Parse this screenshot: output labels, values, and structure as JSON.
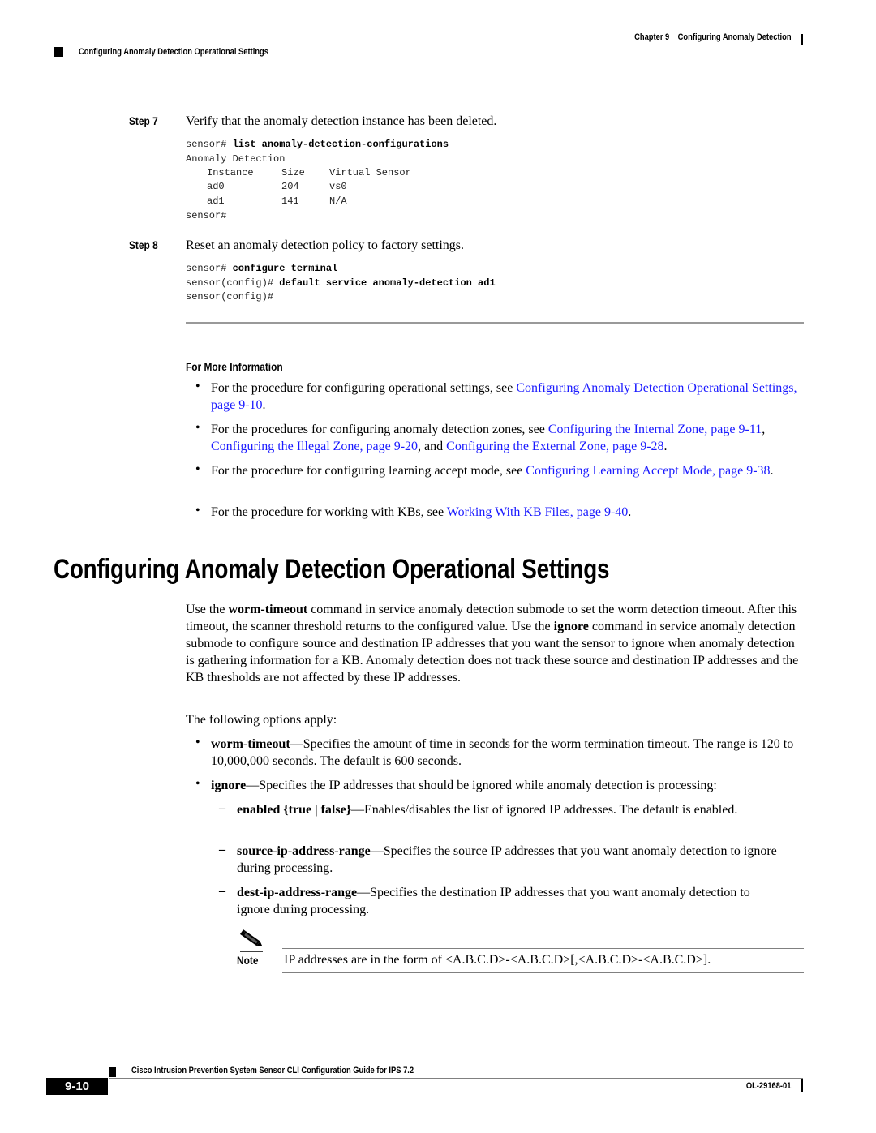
{
  "header": {
    "chapter_label": "Chapter 9",
    "chapter_title": "Configuring Anomaly Detection",
    "section_title": "Configuring Anomaly Detection Operational Settings"
  },
  "steps": [
    {
      "label": "Step 7",
      "text": "Verify that the anomaly detection instance has been deleted.",
      "code": {
        "prompt1": "sensor# ",
        "cmd1": "list anomaly-detection-configurations",
        "line2": "Anomaly Detection",
        "table_header": [
          "Instance",
          "Size",
          "Virtual Sensor"
        ],
        "rows": [
          [
            "ad0",
            "204",
            "vs0"
          ],
          [
            "ad1",
            "141",
            "N/A"
          ]
        ],
        "end_prompt": "sensor#"
      }
    },
    {
      "label": "Step 8",
      "text": "Reset an anomaly detection policy to factory settings.",
      "code": {
        "prompt1": "sensor# ",
        "cmd1": "configure terminal",
        "prompt2": "sensor(config)# ",
        "cmd2": "default service anomaly-detection ad1",
        "end_prompt": "sensor(config)#"
      }
    }
  ],
  "more_info": {
    "title": "For More Information",
    "items": [
      {
        "pre": "For the procedure for configuring operational settings, see ",
        "link1": "Configuring Anomaly Detection Operational Settings, page 9-10",
        "post": "."
      },
      {
        "pre": "For the procedures for configuring anomaly detection zones, see ",
        "link1": "Configuring the Internal Zone, page 9-11",
        "sep1": ", ",
        "link2": "Configuring the Illegal Zone, page 9-20",
        "sep2": ", and ",
        "link3": "Configuring the External Zone, page 9-28",
        "post": "."
      },
      {
        "pre": "For the procedure for configuring learning accept mode, see ",
        "link1": "Configuring Learning Accept Mode, page 9-38",
        "post": "."
      },
      {
        "pre": "For the procedure for working with KBs, see ",
        "link1": "Working With KB Files, page 9-40",
        "post": "."
      }
    ]
  },
  "section": {
    "heading": "Configuring Anomaly Detection Operational Settings",
    "intro": {
      "p1": "Use the ",
      "b1": "worm-timeout",
      "p2": " command in service anomaly detection submode to set the worm detection timeout. After this timeout, the scanner threshold returns to the configured value. Use the ",
      "b2": "ignore",
      "p3": " command in service anomaly detection submode to configure source and destination IP addresses that you want the sensor to ignore when anomaly detection is gathering information for a KB. Anomaly detection does not track these source and destination IP addresses and the KB thresholds are not affected by these IP addresses."
    },
    "options_intro": "The following options apply:",
    "options": [
      {
        "term": "worm-timeout",
        "desc": "—Specifies the amount of time in seconds for the worm termination timeout. The range is 120 to 10,000,000 seconds. The default is 600 seconds."
      },
      {
        "term": "ignore",
        "desc": "—Specifies the IP addresses that should be ignored while anomaly detection is processing:"
      }
    ],
    "sub_options": [
      {
        "term": "enabled {true | false}",
        "desc": "—Enables/disables the list of ignored IP addresses. The default is enabled."
      },
      {
        "term": "source-ip-address-range",
        "desc": "—Specifies the source IP addresses that you want anomaly detection to ignore during processing."
      },
      {
        "term": "dest-ip-address-range",
        "desc": "—Specifies the destination IP addresses that you want anomaly detection to ignore during processing."
      }
    ],
    "note": {
      "label": "Note",
      "text": "IP addresses are in the form of <A.B.C.D>-<A.B.C.D>[,<A.B.C.D>-<A.B.C.D>]."
    }
  },
  "footer": {
    "guide_title": "Cisco Intrusion Prevention System Sensor CLI Configuration Guide for IPS 7.2",
    "page_number": "9-10",
    "doc_number": "OL-29168-01"
  }
}
